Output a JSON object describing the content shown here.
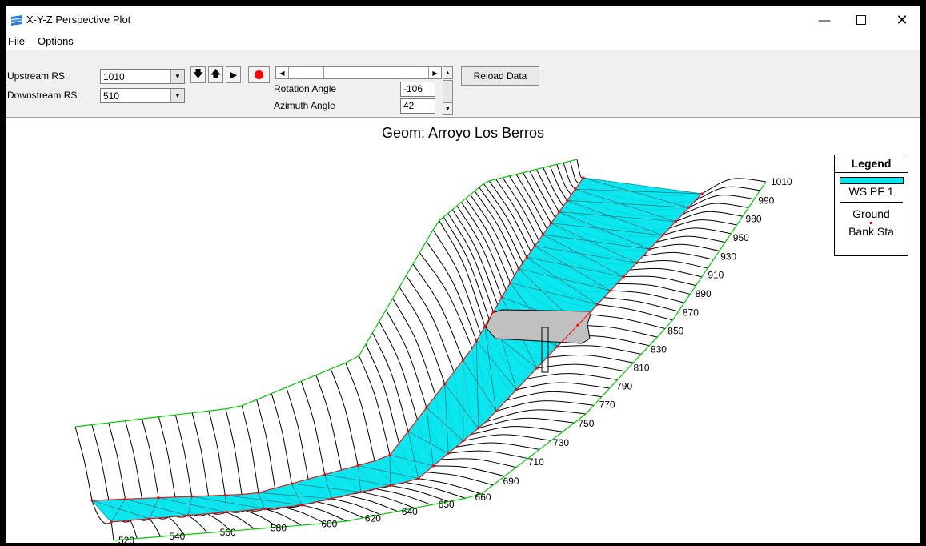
{
  "window": {
    "title": "X-Y-Z Perspective Plot"
  },
  "menu": {
    "items": [
      "File",
      "Options"
    ]
  },
  "toolbar": {
    "upstream_label": "Upstream RS:",
    "upstream_value": "1010",
    "downstream_label": "Downstream RS:",
    "downstream_value": "510",
    "rotation_label": "Rotation Angle",
    "rotation_value": "-106",
    "azimuth_label": "Azimuth Angle",
    "azimuth_value": "42",
    "reload_label": "Reload Data"
  },
  "plot": {
    "title": "Geom: Arroyo Los Berros",
    "legend": {
      "title": "Legend",
      "ws": "WS PF 1",
      "ground": "Ground",
      "bank": "Bank Sta"
    },
    "colors": {
      "water": "#00e5ee",
      "ground": "#000000",
      "bank": "#ff0000",
      "edge": "#00cc00",
      "bridge": "#c0c0c0"
    },
    "station_labels": [
      "1010",
      "990",
      "980",
      "950",
      "930",
      "910",
      "890",
      "870",
      "850",
      "830",
      "810",
      "790",
      "770",
      "750",
      "730",
      "710",
      "690",
      "660",
      "650",
      "640",
      "620",
      "600",
      "580",
      "560",
      "540",
      "520"
    ]
  }
}
